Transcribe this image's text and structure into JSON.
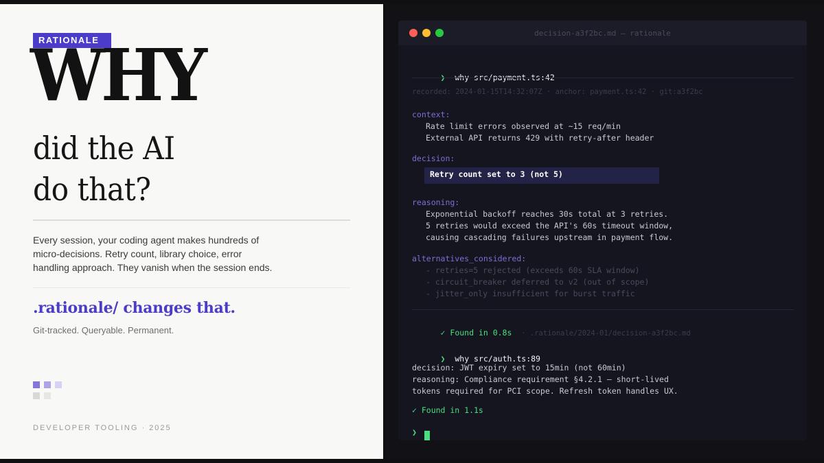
{
  "left": {
    "tag": "RATIONALE",
    "title_main": "WHY",
    "title_sub": "did the AI\ndo that?",
    "description": "Every session, your coding agent makes hundreds of micro-decisions. Retry count, library choice, error handling approach. They vanish when the session ends.",
    "cta": ".rationale/ changes that.",
    "cta_sub": "Git-tracked. Queryable. Permanent.",
    "footer": "DEVELOPER TOOLING · 2025",
    "accent_color": "#4b3cc9"
  },
  "terminal": {
    "window_title": "decision-a3f2bc.md — rationale",
    "prompt_symbol": "❯",
    "command1": "why src/payment.ts:42",
    "meta": "recorded: 2024-01-15T14:32:07Z · anchor: payment.ts:42 · git:a3f2bc",
    "context_label": "context:",
    "context_lines": [
      "Rate limit errors observed at ~15 req/min",
      "External API returns 429 with retry-after header"
    ],
    "decision_label": "decision:",
    "decision_value": "Retry count set to 3 (not 5)",
    "reasoning_label": "reasoning:",
    "reasoning_lines": [
      "Exponential backoff reaches 30s total at 3 retries.",
      "5 retries would exceed the API's 60s timeout window,",
      "causing cascading failures upstream in payment flow."
    ],
    "alternatives_label": "alternatives_considered:",
    "alternatives": [
      "- retries=5 rejected (exceeds 60s SLA window)",
      "- circuit_breaker deferred to v2 (out of scope)",
      "- jitter_only insufficient for burst traffic"
    ],
    "found1": "✓ Found in 0.8s",
    "found1_path": "· .rationale/2024-01/decision-a3f2bc.md",
    "command2": "why src/auth.ts:89",
    "second_lines": [
      "decision: JWT expiry set to 15min (not 60min)",
      "reasoning: Compliance requirement §4.2.1 — short-lived",
      "tokens required for PCI scope. Refresh token handles UX."
    ],
    "found2": "✓ Found in 1.1s",
    "colors": {
      "prompt": "#4ade80",
      "key": "#7b6fd6",
      "decision_bg": "#232348",
      "dot_red": "#ff5f57",
      "dot_yellow": "#febc2e",
      "dot_green": "#28c840"
    }
  }
}
